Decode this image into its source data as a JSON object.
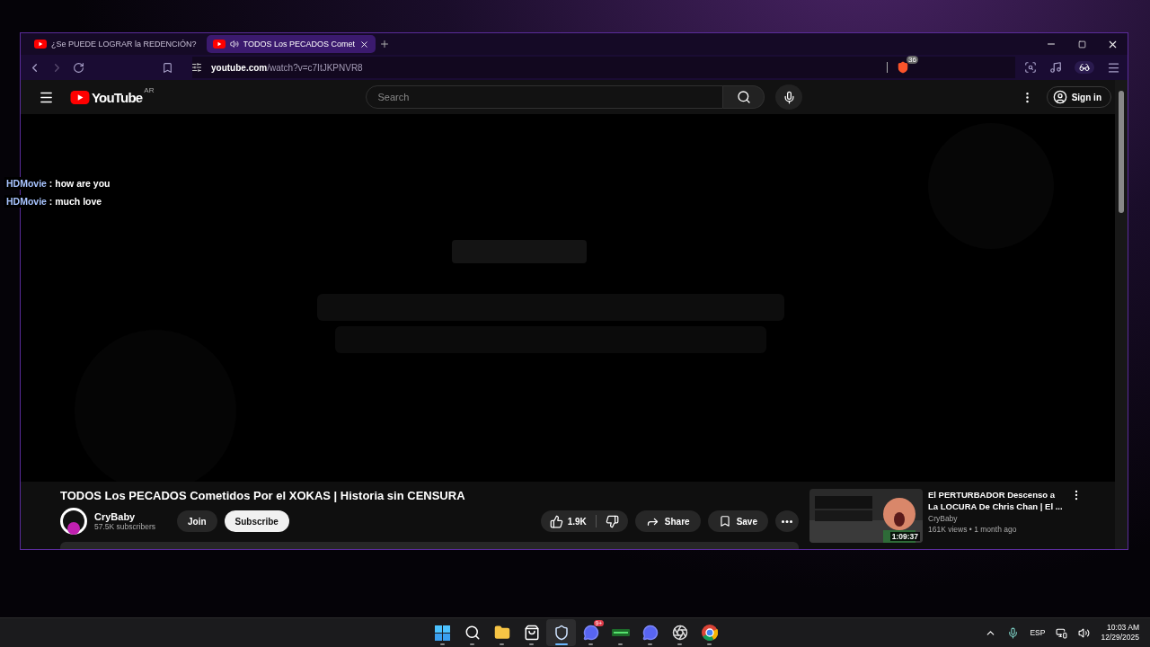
{
  "browser": {
    "tabs": [
      {
        "title": "¿Se PUEDE LOGRAR la REDENCIÓN?",
        "selected": false,
        "audio": false
      },
      {
        "title": "TODOS Los PECADOS Comet",
        "selected": true,
        "audio": true
      }
    ],
    "address": {
      "host": "youtube.com",
      "path": "/watch?v=c7ItJKPNVR8"
    },
    "shield_count": "36"
  },
  "youtube": {
    "logo": "YouTube",
    "region": "AR",
    "search": {
      "placeholder": "Search"
    },
    "sign_in": "Sign in",
    "title": "TODOS Los PECADOS Cometidos Por el XOKAS | Historia sin CENSURA",
    "channel": {
      "name": "CryBaby",
      "subscribers": "57.5K subscribers"
    },
    "join": "Join",
    "subscribe": "Subscribe",
    "likes": "1.9K",
    "share": "Share",
    "save": "Save",
    "recommended": [
      {
        "title": "El PERTURBADOR Descenso a La LOCURA De Chris Chan | El ...",
        "channel": "CryBaby",
        "meta": "161K views • 1 month ago",
        "duration": "1:09:37"
      }
    ]
  },
  "chat": [
    {
      "user": "HDMovie",
      "message": ": how are you"
    },
    {
      "user": "HDMovie",
      "message": ": much love"
    }
  ],
  "taskbar": {
    "apps": [
      {
        "kind": "start",
        "active": false
      },
      {
        "kind": "search",
        "active": false
      },
      {
        "kind": "folder",
        "active": false
      },
      {
        "kind": "store",
        "active": false
      },
      {
        "kind": "lion",
        "active": true
      },
      {
        "kind": "chat",
        "active": false,
        "badge": "9+"
      },
      {
        "kind": "meter",
        "active": false
      },
      {
        "kind": "chat",
        "active": false
      },
      {
        "kind": "recorder",
        "active": false
      },
      {
        "kind": "globe",
        "active": false
      }
    ],
    "language": "ESP",
    "time": "10:03 AM",
    "date": "12/29/2025"
  }
}
